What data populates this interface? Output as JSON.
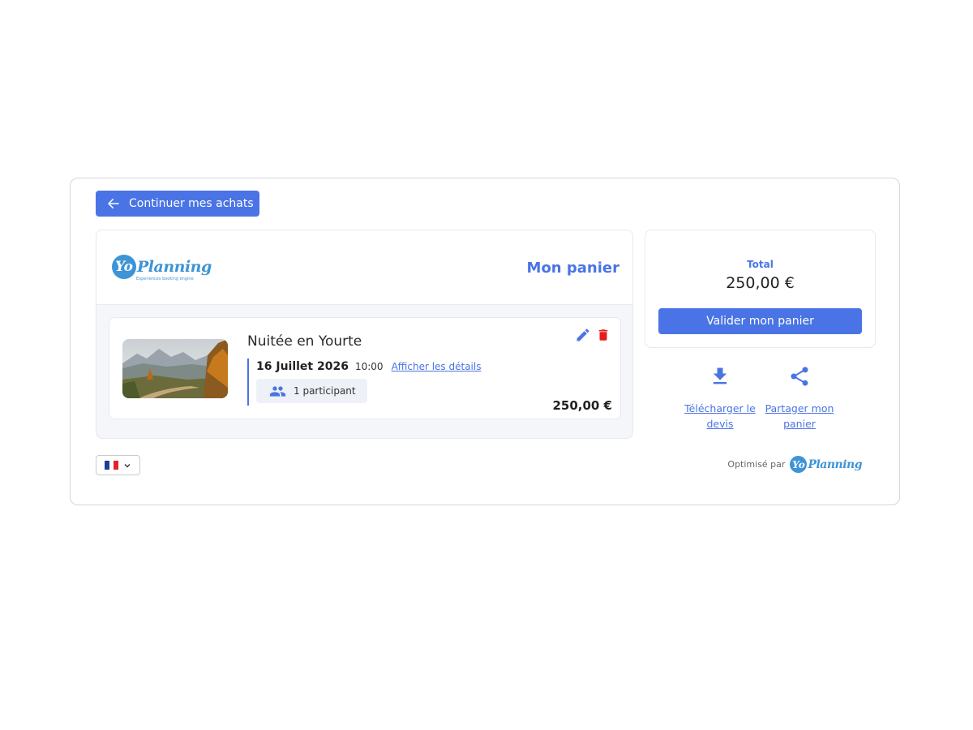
{
  "nav": {
    "back_label": "Continuer mes achats"
  },
  "brand": {
    "logo_yo": "Yo",
    "logo_word": "Planning",
    "logo_tagline": "Experiences booking engine",
    "color": "#3d94d6"
  },
  "cart": {
    "title": "Mon panier",
    "items": [
      {
        "name": "Nuitée en Yourte",
        "date": "16 Juillet 2026",
        "time": "10:00",
        "details_link": "Afficher les détails",
        "participants": "1 participant",
        "price": "250,00 €",
        "image": "mountain-trail-photo"
      }
    ]
  },
  "summary": {
    "total_label": "Total",
    "total_value": "250,00 €",
    "validate_label": "Valider mon panier"
  },
  "actions": {
    "download_label": "Télécharger le devis",
    "share_label": "Partager mon panier"
  },
  "language": {
    "current": "fr",
    "flag": "french-flag"
  },
  "footer": {
    "powered_label": "Optimisé par"
  },
  "colors": {
    "accent": "#4a74e5",
    "delete": "#e41e1e",
    "border": "#d6d6d9",
    "panel_bg": "#f5f6fa"
  },
  "icons": {
    "back": "arrow-left-icon",
    "edit": "pencil-icon",
    "delete": "trash-icon",
    "participants": "people-icon",
    "download": "download-icon",
    "share": "share-icon",
    "dropdown": "chevron-down-icon"
  }
}
